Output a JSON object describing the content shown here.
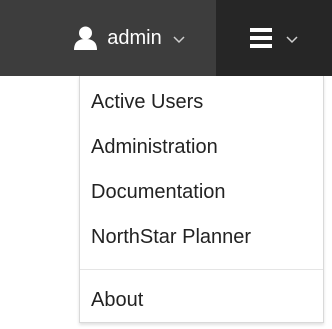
{
  "navbar": {
    "user_menu": {
      "icon": "user-icon",
      "label": "admin",
      "caret_icon": "chevron-down-icon"
    },
    "main_menu": {
      "icon": "hamburger-menu-icon",
      "caret_icon": "chevron-down-icon"
    }
  },
  "dropdown": {
    "items": [
      {
        "label": "Active Users"
      },
      {
        "label": "Administration"
      },
      {
        "label": "Documentation"
      },
      {
        "label": "NorthStar Planner"
      },
      {
        "label": "About"
      }
    ]
  },
  "colors": {
    "navbar_bg": "#3d3d3d",
    "active_menu_bg": "#262626",
    "nav_text": "#ffffff",
    "menu_text": "#222222",
    "menu_border": "#d9d9d9",
    "divider": "#e5e5e5"
  }
}
